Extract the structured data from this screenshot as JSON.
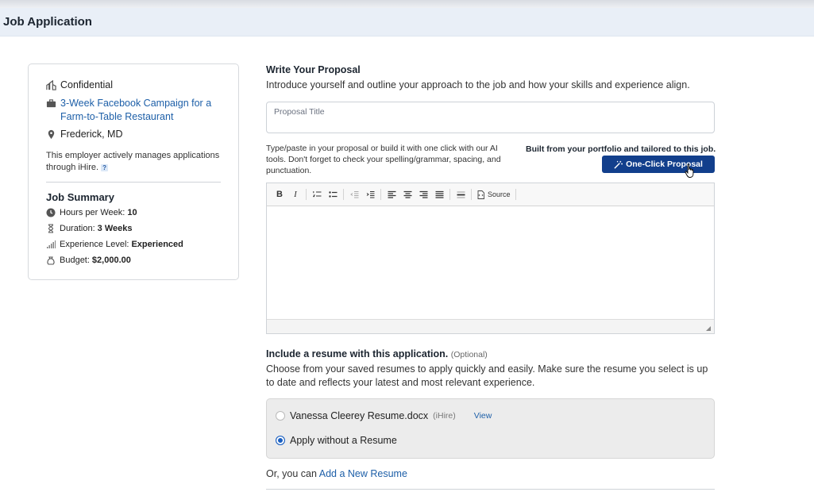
{
  "header": {
    "title": "Job Application"
  },
  "job": {
    "company": "Confidential",
    "title": "3-Week Facebook Campaign for a Farm-to-Table Restaurant",
    "location": "Frederick, MD",
    "employer_note": "This employer actively manages applications through iHire.",
    "help_glyph": "?"
  },
  "summary": {
    "title": "Job Summary",
    "items": [
      {
        "label": "Hours per Week:",
        "value": "10",
        "icon": "clock-icon"
      },
      {
        "label": "Duration:",
        "value": "3 Weeks",
        "icon": "hourglass-icon"
      },
      {
        "label": "Experience Level:",
        "value": "Experienced",
        "icon": "signal-bars-icon"
      },
      {
        "label": "Budget:",
        "value": "$2,000.00",
        "icon": "money-bag-icon"
      }
    ]
  },
  "proposal": {
    "title": "Write Your Proposal",
    "intro": "Introduce yourself and outline your approach to the job and how your skills and experience align.",
    "title_placeholder": "Proposal Title",
    "help_text": "Type/paste in your proposal or build it with one click with our AI tools. Don't forget to check your spelling/grammar, spacing, and punctuation.",
    "built_label": "Built from your portfolio and tailored to this job.",
    "one_click_label": "One-Click Proposal",
    "toolbar": {
      "bold": "B",
      "italic": "I",
      "source": "Source"
    }
  },
  "resume": {
    "title": "Include a resume with this application.",
    "optional": "(Optional)",
    "description": "Choose from your saved resumes to apply quickly and easily. Make sure the resume you select is up to date and reflects your latest and most relevant experience.",
    "options": [
      {
        "label": "Vanessa Cleerey Resume.docx",
        "source": "(iHire)",
        "action": "View",
        "selected": false
      },
      {
        "label": "Apply without a Resume",
        "selected": true
      }
    ],
    "alt_prefix": "Or, you can",
    "alt_link": "Add a New Resume"
  },
  "colors": {
    "primary_button": "#123f8c",
    "link": "#1d5fa8",
    "header_bg": "#e9eff7"
  }
}
